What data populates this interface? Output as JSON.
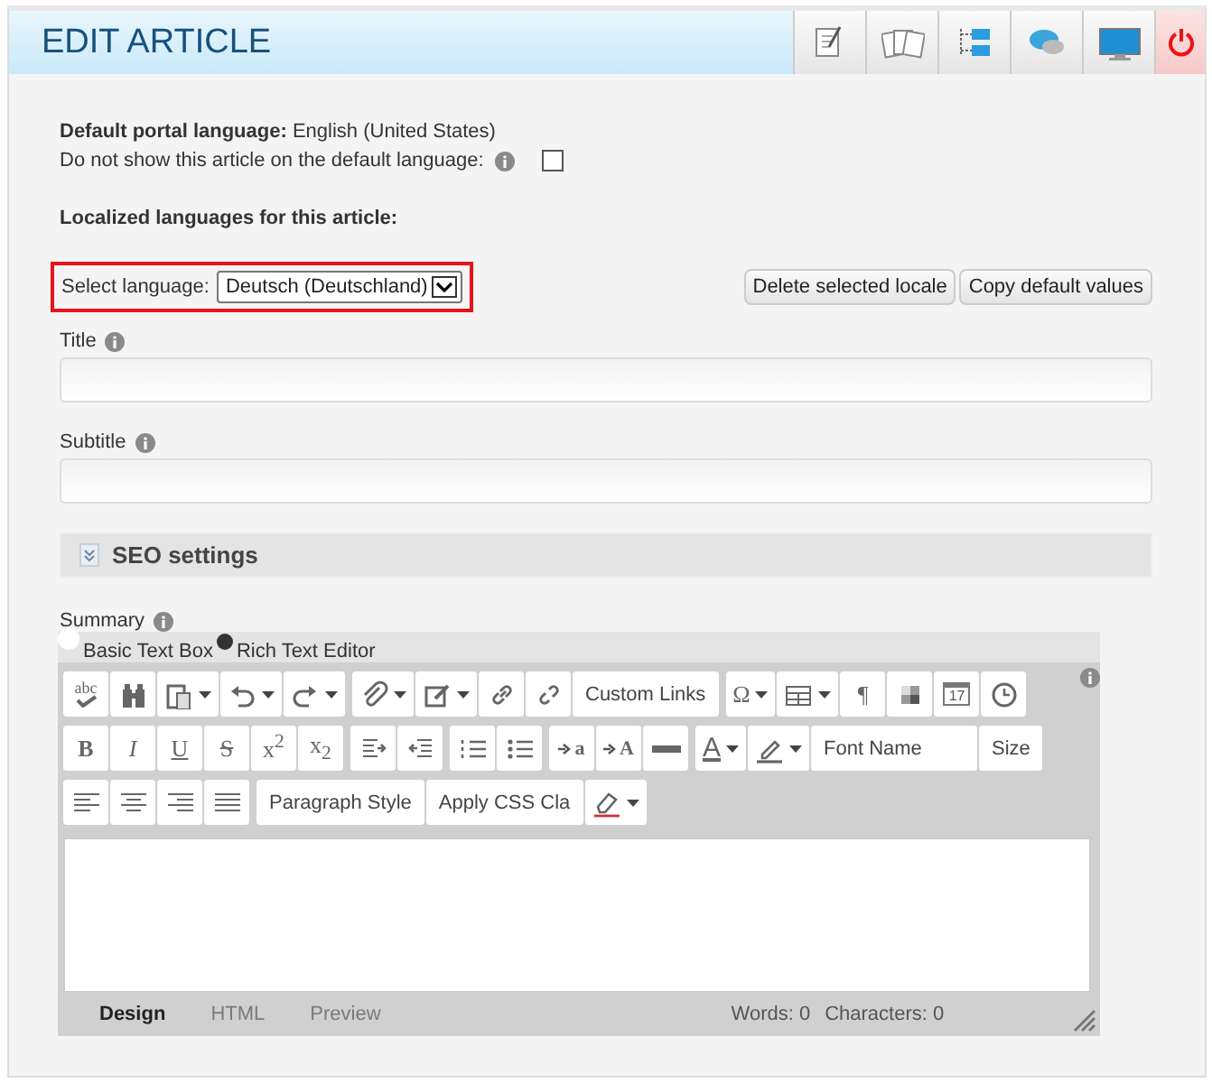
{
  "header": {
    "title": "EDIT ARTICLE"
  },
  "default_language": {
    "label": "Default portal language:",
    "value": "English (United States)"
  },
  "hide_on_default": {
    "label": "Do not show this article on the default language:",
    "checked": false
  },
  "localized_heading": "Localized languages for this article:",
  "select_language": {
    "label": "Select language:",
    "value": "Deutsch (Deutschland)",
    "highlighted": true
  },
  "locale_buttons": [
    "Delete selected locale",
    "Copy default values"
  ],
  "fields": [
    {
      "label": "Title"
    },
    {
      "label": "Subtitle"
    }
  ],
  "seo_section": {
    "title": "SEO settings",
    "expanded": false
  },
  "summary": {
    "label": "Summary",
    "modes": [
      {
        "label": "Basic Text Box",
        "selected": false
      },
      {
        "label": "Rich Text Editor",
        "selected": true
      }
    ],
    "toolbar": [
      [
        [
          {
            "kind": "spell",
            "label": "abc"
          },
          {
            "kind": "icon"
          },
          {
            "kind": "icon",
            "dropdown": true
          },
          {
            "kind": "icon",
            "dropdown": true
          },
          {
            "kind": "icon",
            "dropdown": true
          }
        ],
        [
          {
            "kind": "icon",
            "dropdown": true
          },
          {
            "kind": "icon",
            "dropdown": true
          },
          {
            "kind": "icon"
          },
          {
            "kind": "icon"
          },
          {
            "kind": "text",
            "label": "Custom Links"
          }
        ],
        [
          {
            "kind": "glyph",
            "label": "Ω",
            "dropdown": true
          },
          {
            "kind": "icon",
            "dropdown": true
          },
          {
            "kind": "glyph",
            "label": "¶"
          },
          {
            "kind": "icon"
          },
          {
            "kind": "calendar",
            "label": "17"
          },
          {
            "kind": "icon"
          }
        ]
      ],
      [
        [
          {
            "kind": "glyph",
            "label": "**B**"
          },
          {
            "kind": "glyph",
            "label": "*I*"
          },
          {
            "kind": "glyph",
            "label": "U",
            "underline": true
          },
          {
            "kind": "glyph",
            "label": "S",
            "strike": true
          },
          {
            "kind": "glyph",
            "label": "x$^{2}$"
          },
          {
            "kind": "glyph",
            "label": "x$_{2}$"
          }
        ],
        [
          {
            "kind": "icon"
          },
          {
            "kind": "icon"
          }
        ],
        [
          {
            "kind": "icon"
          },
          {
            "kind": "icon"
          }
        ],
        [
          {
            "kind": "case",
            "label": "a"
          },
          {
            "kind": "case",
            "label": "A"
          },
          {
            "kind": "icon"
          }
        ],
        [
          {
            "kind": "fontcolor",
            "label": "A",
            "dropdown": true
          },
          {
            "kind": "icon",
            "dropdown": true
          },
          {
            "kind": "text",
            "label": "Font Name",
            "wide": true
          },
          {
            "kind": "text",
            "label": "Size"
          }
        ]
      ],
      [
        [
          {
            "kind": "icon"
          },
          {
            "kind": "icon"
          },
          {
            "kind": "icon"
          },
          {
            "kind": "icon"
          }
        ],
        [
          {
            "kind": "text",
            "label": "Paragraph Style",
            "wide": true
          },
          {
            "kind": "text",
            "label": "Apply CSS Cla"
          },
          {
            "kind": "icon",
            "dropdown": true
          }
        ]
      ]
    ],
    "views": [
      {
        "label": "Design",
        "selected": true
      },
      {
        "label": "HTML",
        "selected": false
      },
      {
        "label": "Preview",
        "selected": false
      }
    ],
    "words": "Words: 0",
    "characters": "Characters: 0"
  }
}
